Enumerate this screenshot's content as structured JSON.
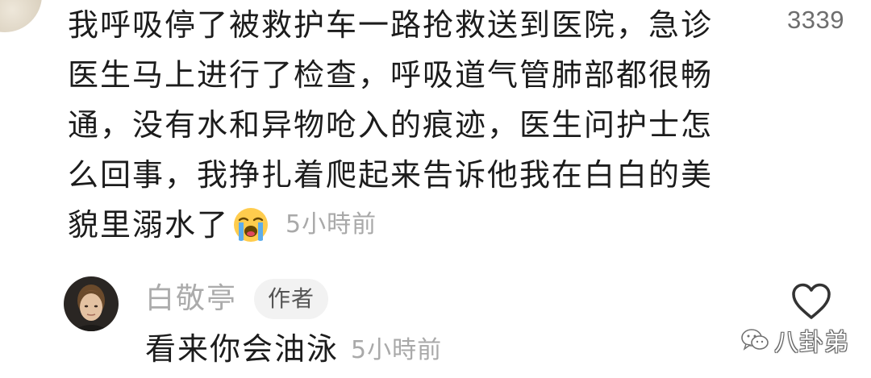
{
  "thread": {
    "comment": {
      "avatar": "commenter-avatar",
      "lines": [
        "我呼吸停了被救护车一路抢救送到医院，急诊",
        "医生马上进行了检查，呼吸道气管肺部都很畅",
        "通，没有水和异物呛入的痕迹，医生问护士怎",
        "么回事，我挣扎着爬起来告诉他我在白白的美"
      ],
      "last_line": "貌里溺水了",
      "emoji": "loudly-crying-face-emoji",
      "time": "5小時前",
      "likes": "3339"
    },
    "reply": {
      "avatar": "author-avatar",
      "author": "白敬亭",
      "badge": "作者",
      "text": "看来你会油泳",
      "time": "5小時前",
      "like_icon": "heart-outline-icon"
    }
  },
  "watermark": {
    "icon": "wechat-icon",
    "text": "八卦弟"
  },
  "colors": {
    "background": "#ffffff",
    "text_primary": "#1c1c1c",
    "text_secondary": "#a9a9a9",
    "badge_background": "#f2f2f2",
    "badge_text": "#555555",
    "like_count": "#6e6e6e"
  }
}
